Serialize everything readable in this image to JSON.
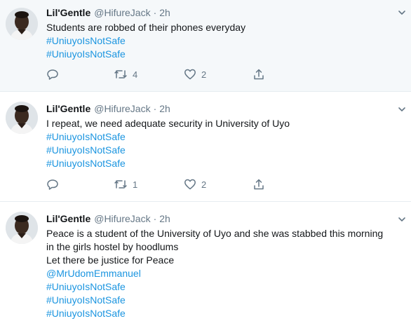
{
  "tweets": [
    {
      "name": "Lil'Gentle",
      "handle": "@HifureJack",
      "separator": "·",
      "time": "2h",
      "lines": [
        "Students are robbed of their phones everyday",
        "#UniuyoIsNotSafe",
        "#UniuyoIsNotSafe"
      ],
      "retweets": "4",
      "likes": "2"
    },
    {
      "name": "Lil'Gentle",
      "handle": "@HifureJack",
      "separator": "·",
      "time": "2h",
      "lines": [
        "I repeat, we need adequate security in University of Uyo",
        "#UniuyoIsNotSafe",
        "#UniuyoIsNotSafe",
        "#UniuyoIsNotSafe"
      ],
      "retweets": "1",
      "likes": "2"
    },
    {
      "name": "Lil'Gentle",
      "handle": "@HifureJack",
      "separator": "·",
      "time": "2h",
      "lines": [
        "Peace is a student of the University of Uyo and she was stabbed this morning",
        "in the girls hostel by hoodlums",
        "Let there be justice for Peace",
        "@MrUdomEmmanuel",
        "#UniuyoIsNotSafe",
        "#UniuyoIsNotSafe",
        "#UniuyoIsNotSafe"
      ]
    }
  ],
  "colors": {
    "link": "#1b95e0",
    "muted": "#657786",
    "highlight_bg": "#f5f8fa",
    "divider": "#e6ecf0"
  },
  "icons": [
    "avatar-photo",
    "chevron-down-icon",
    "reply-icon",
    "retweet-icon",
    "like-icon",
    "share-icon"
  ]
}
